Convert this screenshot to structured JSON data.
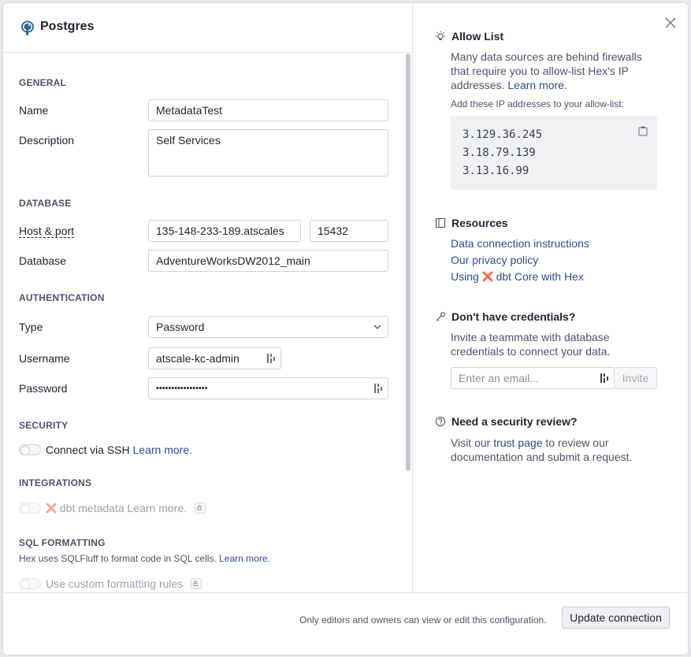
{
  "header": {
    "title": "Postgres",
    "logo_icon": "postgres-elephant-icon"
  },
  "sections": {
    "general": "GENERAL",
    "database": "DATABASE",
    "authentication": "AUTHENTICATION",
    "security": "SECURITY",
    "integrations": "INTEGRATIONS",
    "sql_formatting": "SQL FORMATTING"
  },
  "fields": {
    "name": {
      "label": "Name",
      "value": "MetadataTest"
    },
    "description": {
      "label": "Description",
      "value": "Self Services"
    },
    "host_port": {
      "label": "Host & port",
      "host": "135-148-233-189.atscales",
      "port": "15432"
    },
    "database": {
      "label": "Database",
      "value": "AdventureWorksDW2012_main"
    },
    "type": {
      "label": "Type",
      "value": "Password"
    },
    "username": {
      "label": "Username",
      "value": "atscale-kc-admin"
    },
    "password": {
      "label": "Password",
      "value": "•••••••••••••••••"
    }
  },
  "security": {
    "ssh_label": "Connect via SSH",
    "learn_more": "Learn more."
  },
  "integrations": {
    "dbt_label": "dbt metadata",
    "learn_more": "Learn more."
  },
  "sql_formatting": {
    "note": "Hex uses SQLFluff to format code in SQL cells.",
    "learn_more": "Learn more.",
    "custom_label": "Use custom formatting rules"
  },
  "footer": {
    "note": "Only editors and owners can view or edit this configuration.",
    "update_button": "Update connection"
  },
  "allow_list": {
    "title": "Allow List",
    "text": "Many data sources are behind firewalls that require you to allow-list Hex's IP addresses.",
    "learn_more": "Learn more.",
    "ip_label": "Add these IP addresses to your allow-list:",
    "ips": [
      "3.129.36.245",
      "3.18.79.139",
      "3.13.16.99"
    ]
  },
  "resources": {
    "title": "Resources",
    "links": [
      "Data connection instructions",
      "Our privacy policy"
    ],
    "dbt_prefix": "Using",
    "dbt_suffix": "dbt Core with Hex"
  },
  "credentials": {
    "title": "Don't have credentials?",
    "text": "Invite a teammate with database credentials to connect your data.",
    "email_placeholder": "Enter an email...",
    "invite_button": "Invite"
  },
  "security_review": {
    "title": "Need a security review?",
    "text_prefix": "Visit our",
    "link": "trust page",
    "text_suffix": "to review our documentation and submit a request."
  },
  "colors": {
    "link": "#2b4e8c",
    "dbt_orange": "#ff694a"
  }
}
